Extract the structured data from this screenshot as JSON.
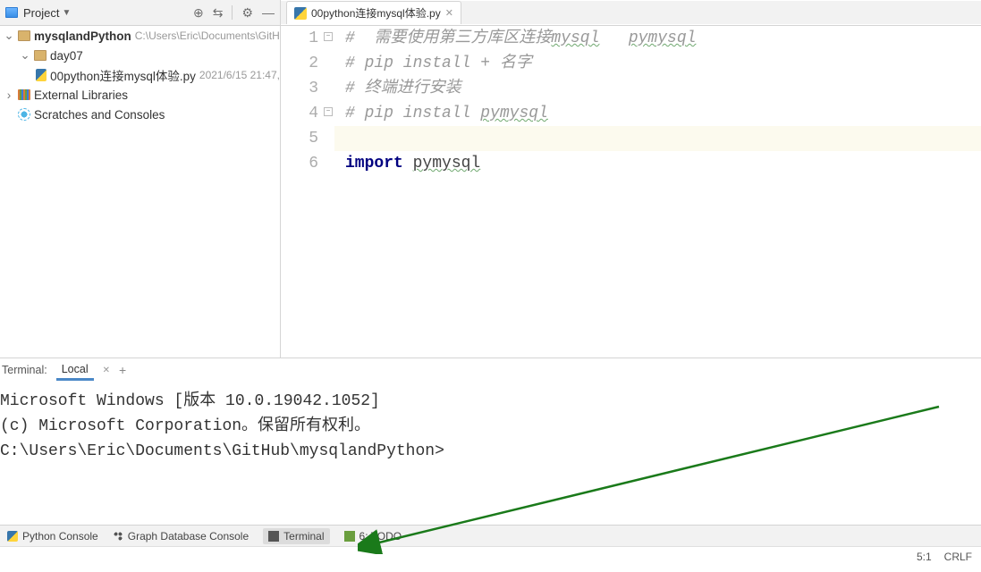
{
  "project_toolbar": {
    "label": "Project",
    "actions": {
      "target": "⊕",
      "collapse": "⇆",
      "gear": "⚙",
      "hide": "—"
    }
  },
  "editor_tab": {
    "filename": "00python连接mysql体验.py"
  },
  "tree": {
    "root": {
      "name": "mysqlandPython",
      "path": "C:\\Users\\Eric\\Documents\\GitH"
    },
    "folder": {
      "name": "day07"
    },
    "file": {
      "name": "00python连接mysql体验.py",
      "meta": "2021/6/15 21:47,"
    },
    "ext_lib": "External Libraries",
    "scratch": "Scratches and Consoles"
  },
  "code": {
    "l1a": "#  需要使用第三方库区连接",
    "l1b": "mysql",
    "l1c": "   ",
    "l1d": "pymysql",
    "l2": "# pip install + 名字",
    "l3": "# 终端进行安装",
    "l4a": "# pip install ",
    "l4b": "pymysql",
    "l6a": "import",
    "l6b": " ",
    "l6c": "pymysql",
    "n1": "1",
    "n2": "2",
    "n3": "3",
    "n4": "4",
    "n5": "5",
    "n6": "6"
  },
  "terminal": {
    "title": "Terminal:",
    "tab": "Local",
    "lines": {
      "l1": "Microsoft Windows [版本 10.0.19042.1052]",
      "l2": "(c) Microsoft Corporation。保留所有权利。",
      "l3": "",
      "l4": "C:\\Users\\Eric\\Documents\\GitHub\\mysqlandPython>"
    }
  },
  "bottom": {
    "python_console": "Python Console",
    "graph_console": "Graph Database Console",
    "terminal": "Terminal",
    "todo": "6: TODO"
  },
  "status": {
    "pos": "5:1",
    "le": "CRLF"
  }
}
